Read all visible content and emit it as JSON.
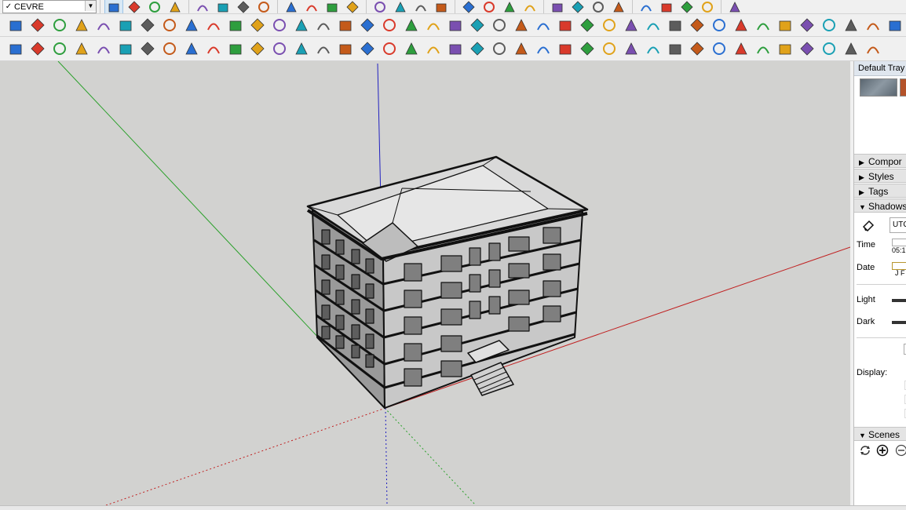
{
  "toolbar": {
    "tag_selector": {
      "checked": "✓",
      "value": "CEVRE",
      "arrow": "▼"
    }
  },
  "tray": {
    "title": "Default Tray",
    "panels": {
      "components": {
        "label": "Compor",
        "state": "collapsed"
      },
      "styles": {
        "label": "Styles",
        "state": "collapsed"
      },
      "tags": {
        "label": "Tags",
        "state": "collapsed"
      },
      "shadows": {
        "label": "Shadows",
        "state": "expanded"
      },
      "scenes": {
        "label": "Scenes",
        "state": "expanded"
      }
    },
    "shadows": {
      "timezone": "UTC",
      "time_label": "Time",
      "time_value": "05:1",
      "date_label": "Date",
      "date_value": "J F",
      "light_label": "Light",
      "dark_label": "Dark",
      "display_label": "Display:"
    }
  },
  "icons": {
    "row1": [
      "select-icon",
      "eraser-icon",
      "pencil-icon",
      "arc-icon",
      "rectangle-icon",
      "paint-bucket-icon",
      "orbit-icon",
      "pan-icon",
      "rotate-icon",
      "push-pull-icon",
      "move-icon",
      "offset-icon",
      "tape-icon",
      "zoom-icon",
      "zoom-window-icon",
      "paint-icon",
      "walk-icon",
      "section-icon",
      "solid-tools-icon",
      "x-ray-icon",
      "iso-view-icon",
      "top-view-icon",
      "front-view-icon",
      "right-view-icon",
      "back-view-icon",
      "left-view-icon",
      "layer-stack-icon",
      "style-icon",
      "warehouse-icon"
    ],
    "row2": [
      "blue-plane-icon",
      "blue-diamond-icon",
      "yellow-plane-icon",
      "green-plane-icon",
      "red-plane-icon",
      "white-plane-icon",
      "orange-swirl-icon",
      "red-square-icon",
      "grid-icon",
      "flag-icon",
      "folder-icon",
      "chain-icon",
      "curve-icon",
      "bezier-icon",
      "red-cross-icon",
      "green-cross-icon",
      "blue-x-icon",
      "teal-triangle-icon",
      "teal-triangle-outline-icon",
      "yellow-triangle-icon",
      "hook-icon",
      "gear-shape-icon",
      "ring-icon",
      "star-move-icon",
      "bucket-icon",
      "red-arc-icon",
      "green-shape-icon",
      "cube-outline-icon",
      "cube-pair-icon",
      "cube-red-icon",
      "box-red-icon",
      "dots-icon",
      "square-outline-icon",
      "orange-grid-icon",
      "orange-grid-2-icon",
      "yellow-grid-icon",
      "red-dots-icon",
      "circle-dots-icon",
      "column-icon",
      "brick-icon",
      "copy-box-icon",
      "copy-box-2-icon",
      "stack-box-icon",
      "gradient-box-icon"
    ],
    "row3": [
      "location-icon",
      "refresh-icon",
      "arrow-bar-icon",
      "add-circle-icon",
      "tree-icon",
      "terrain-icon",
      "checker-sphere-icon",
      "cloud-icon",
      "settings-gear-icon",
      "mail-icon",
      "info-icon",
      "path-icon",
      "polyline-icon",
      "paint-line-icon",
      "split-icon",
      "round-icon",
      "blob-icon",
      "weave-icon",
      "wire-icon",
      "curve-up-icon",
      "corner-icon",
      "corner-2-icon",
      "slant-icon",
      "fillet-icon",
      "cylinder-icon",
      "cone-icon",
      "zigzag-icon",
      "wave-icon",
      "hand-icon",
      "fold-icon",
      "twist-icon",
      "slash-icon",
      "ramp-icon",
      "stair-icon",
      "sweep-icon",
      "tile-icon",
      "tile-2-icon",
      "tile-3-icon",
      "tile-4-icon",
      "tile-5-icon"
    ]
  }
}
